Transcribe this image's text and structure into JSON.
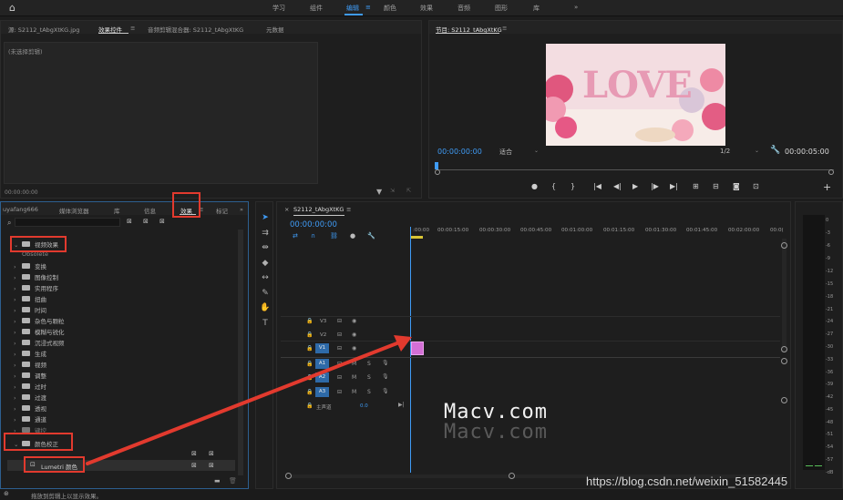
{
  "topbar": {
    "workspaces": [
      "学习",
      "组件",
      "编辑",
      "颜色",
      "效果",
      "音频",
      "图形",
      "库"
    ],
    "active": "编辑",
    "more": "»"
  },
  "source_panel": {
    "tabs": [
      "源: S2112_tAbgXtKG.jpg",
      "效果控件",
      "音频剪辑混合器: S2112_tAbgXtKG",
      "元数据"
    ],
    "active_tab": "效果控件",
    "no_clip": "(未选择剪辑)",
    "timecode": "00:00:00:00"
  },
  "program_panel": {
    "title": "节目: S2112_tAbgXtKG",
    "timecode_left": "00:00:00:00",
    "fit_label": "适合",
    "resolution": "1/2",
    "timecode_right": "00:00:05:00",
    "video_text": "LOVE"
  },
  "effects_panel": {
    "tabs": [
      "uyafang666",
      "媒体浏览器",
      "库",
      "信息",
      "效果",
      "标记",
      "»"
    ],
    "active_tab": "效果",
    "items": [
      {
        "label": "视频效果",
        "kind": "folder",
        "expanded": true
      },
      {
        "label": "Obsolete",
        "kind": "folder"
      },
      {
        "label": "变换",
        "kind": "folder"
      },
      {
        "label": "图像控制",
        "kind": "folder"
      },
      {
        "label": "实用程序",
        "kind": "folder"
      },
      {
        "label": "扭曲",
        "kind": "folder"
      },
      {
        "label": "时间",
        "kind": "folder"
      },
      {
        "label": "杂色与颗粒",
        "kind": "folder"
      },
      {
        "label": "模糊与锐化",
        "kind": "folder"
      },
      {
        "label": "沉浸式视频",
        "kind": "folder"
      },
      {
        "label": "生成",
        "kind": "folder"
      },
      {
        "label": "视频",
        "kind": "folder"
      },
      {
        "label": "调整",
        "kind": "folder"
      },
      {
        "label": "过时",
        "kind": "folder"
      },
      {
        "label": "过渡",
        "kind": "folder"
      },
      {
        "label": "透视",
        "kind": "folder"
      },
      {
        "label": "通道",
        "kind": "folder"
      },
      {
        "label": "键控",
        "kind": "folder"
      },
      {
        "label": "颜色校正",
        "kind": "folder",
        "expanded": true
      },
      {
        "label": "Lumetri 颜色",
        "kind": "effect"
      }
    ],
    "status": "拖放到剪辑上以显示效果。"
  },
  "timeline": {
    "tab": "S2112_tAbgXtKG",
    "timecode": "00:00:00:00",
    "ruler": [
      ":00:00",
      "00:00:15:00",
      "00:00:30:00",
      "00:00:45:00",
      "00:01:00:00",
      "00:01:15:00",
      "00:01:30:00",
      "00:01:45:00",
      "00:02:00:00",
      "00:0("
    ],
    "video_tracks": [
      "V3",
      "V2",
      "V1"
    ],
    "audio_tracks": [
      "A1",
      "A2",
      "A3"
    ],
    "master_label": "主声道",
    "master_value": "0.0",
    "mute_letter": "M",
    "solo_letter": "S"
  },
  "meters": {
    "scale": [
      "0",
      "-3",
      "-6",
      "-9",
      "-12",
      "-15",
      "-18",
      "-21",
      "-24",
      "-27",
      "-30",
      "-33",
      "-36",
      "-39",
      "-42",
      "-45",
      "-48",
      "-51",
      "-54",
      "-57",
      "-dB"
    ]
  },
  "overlay": {
    "watermark": "Macv.com",
    "credit": "https://blog.csdn.net/weixin_51582445"
  },
  "colors": {
    "accent": "#3f9bf5",
    "annotation": "#e23a2e",
    "clip": "#d46fd6"
  }
}
